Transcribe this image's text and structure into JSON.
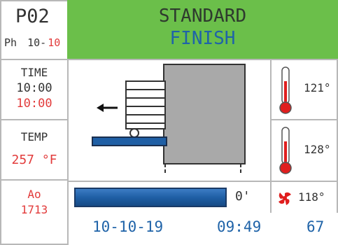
{
  "program": {
    "code": "P02",
    "phase_label": "Ph",
    "phase_current": "10-",
    "phase_total": "10"
  },
  "header": {
    "mode": "STANDARD",
    "stage": "FINISH",
    "bg_color": "#6bbf4a"
  },
  "time": {
    "label": "TIME",
    "set": "10:00",
    "remaining": "10:00"
  },
  "temp": {
    "label": "TEMP",
    "value": "257 °F"
  },
  "sensors": [
    {
      "icon": "thermometer-icon",
      "value": "121°"
    },
    {
      "icon": "thermometer-icon",
      "value": "128°"
    },
    {
      "icon": "fan-icon",
      "value": "118°"
    }
  ],
  "ao": {
    "label": "Ao",
    "value": "1713"
  },
  "progress": {
    "fraction": 1.0,
    "label": "0'",
    "color": "#1f5fa5"
  },
  "footer": {
    "date": "10-10-19",
    "time": "09:49",
    "number": "67"
  },
  "colors": {
    "accent_red": "#e23b3b",
    "accent_blue": "#1f63a8",
    "grid": "#b8b8b8"
  }
}
